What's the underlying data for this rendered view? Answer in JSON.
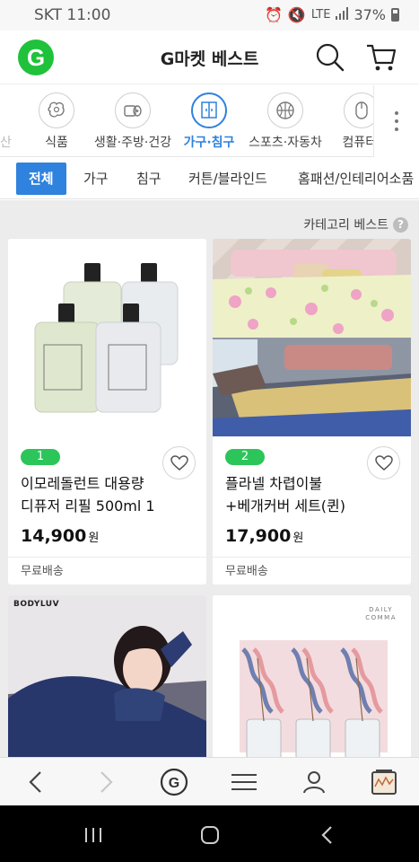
{
  "status_bar": {
    "carrier": "SKT",
    "time": "11:00",
    "network": "LTE",
    "battery": "37%"
  },
  "header": {
    "logo_letter": "G",
    "title": "G마켓 베스트"
  },
  "categories": {
    "partial_left": "산",
    "items": [
      {
        "label": "식품",
        "icon": "food-icon"
      },
      {
        "label": "생활·주방·건강",
        "icon": "tissue-icon"
      },
      {
        "label": "가구·침구",
        "icon": "furniture-icon",
        "active": true
      },
      {
        "label": "스포츠·자동차",
        "icon": "ball-icon"
      },
      {
        "label": "컴퓨터·",
        "icon": "mouse-icon"
      }
    ]
  },
  "sub_tabs": [
    "전체",
    "가구",
    "침구",
    "커튼/블라인드",
    "홈패션/인테리어소품"
  ],
  "best_label": "카테고리 베스트",
  "help_symbol": "?",
  "products": [
    {
      "rank": "1",
      "name": "이모레돌런트 대용량 디퓨저 리필 500ml 1",
      "price": "14,900",
      "unit": "원",
      "shipping": "무료배송"
    },
    {
      "rank": "2",
      "name": "플라넬 차렵이불+베개커버 세트(퀸)",
      "price": "17,900",
      "unit": "원",
      "shipping": "무료배송"
    },
    {
      "brand": "BODYLUV"
    },
    {
      "brand_line1": "DAILY",
      "brand_line2": "COMMA"
    }
  ],
  "colors": {
    "accent": "#2f82dd",
    "logo_green": "#1fc23a",
    "rank_green": "#2cc55a"
  }
}
